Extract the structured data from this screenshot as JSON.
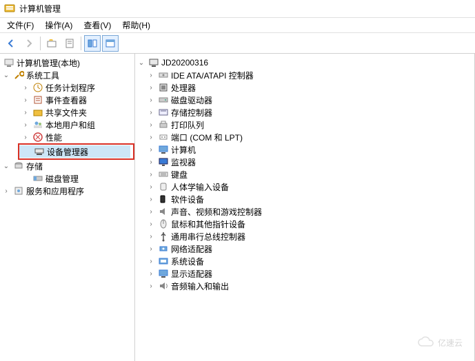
{
  "title": "计算机管理",
  "menu": {
    "file": "文件(F)",
    "action": "操作(A)",
    "view": "查看(V)",
    "help": "帮助(H)"
  },
  "toolbar_icons": {
    "back": "back-arrow",
    "forward": "forward-arrow",
    "up": "folder-up",
    "props": "properties",
    "pane1": "pane-view-1",
    "pane2": "pane-view-2"
  },
  "left_tree": {
    "root": "计算机管理(本地)",
    "system_tools": {
      "label": "系统工具",
      "children": [
        {
          "label": "任务计划程序",
          "icon": "clock"
        },
        {
          "label": "事件查看器",
          "icon": "event"
        },
        {
          "label": "共享文件夹",
          "icon": "share"
        },
        {
          "label": "本地用户和组",
          "icon": "users"
        },
        {
          "label": "性能",
          "icon": "perf"
        },
        {
          "label": "设备管理器",
          "icon": "device",
          "highlighted": true,
          "selected": true
        }
      ]
    },
    "storage": {
      "label": "存储",
      "children": [
        {
          "label": "磁盘管理",
          "icon": "disk"
        }
      ]
    },
    "services": {
      "label": "服务和应用程序",
      "icon": "services"
    }
  },
  "right_tree": {
    "root": "JD20200316",
    "children": [
      {
        "label": "IDE ATA/ATAPI 控制器",
        "icon": "ide"
      },
      {
        "label": "处理器",
        "icon": "cpu"
      },
      {
        "label": "磁盘驱动器",
        "icon": "disk-drive"
      },
      {
        "label": "存储控制器",
        "icon": "storage-ctrl"
      },
      {
        "label": "打印队列",
        "icon": "printer"
      },
      {
        "label": "端口 (COM 和 LPT)",
        "icon": "port"
      },
      {
        "label": "计算机",
        "icon": "computer"
      },
      {
        "label": "监视器",
        "icon": "monitor"
      },
      {
        "label": "键盘",
        "icon": "keyboard"
      },
      {
        "label": "人体学输入设备",
        "icon": "hid"
      },
      {
        "label": "软件设备",
        "icon": "soft-dev"
      },
      {
        "label": "声音、视频和游戏控制器",
        "icon": "audio"
      },
      {
        "label": "鼠标和其他指针设备",
        "icon": "mouse"
      },
      {
        "label": "通用串行总线控制器",
        "icon": "usb"
      },
      {
        "label": "网络适配器",
        "icon": "network"
      },
      {
        "label": "系统设备",
        "icon": "system"
      },
      {
        "label": "显示适配器",
        "icon": "display"
      },
      {
        "label": "音频输入和输出",
        "icon": "audio-io"
      }
    ]
  },
  "watermark": "亿速云"
}
